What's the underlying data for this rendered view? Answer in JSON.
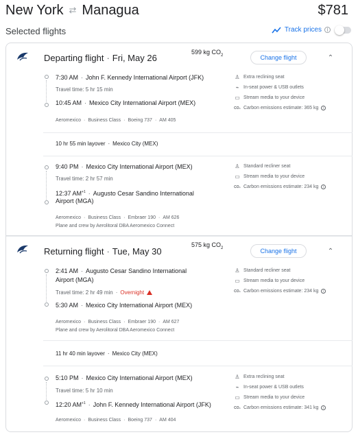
{
  "header": {
    "origin": "New York",
    "swap_glyph": "⇄",
    "destination": "Managua",
    "price": "$781"
  },
  "selected": {
    "label": "Selected flights",
    "track_label": "Track prices",
    "info_glyph": "i"
  },
  "departing": {
    "title": "Departing flight",
    "date": "Fri, May 26",
    "co2_value": "599 kg CO",
    "co2_sub": "2",
    "change_label": "Change flight",
    "segments": [
      {
        "dep_time": "7:30 AM",
        "dep_airport": "John F. Kennedy International Airport (JFK)",
        "travel_time": "Travel time: 5 hr 15 min",
        "arr_time": "10:45 AM",
        "arr_airport": "Mexico City International Airport (MEX)",
        "airline": "Aeromexico",
        "cabin": "Business Class",
        "aircraft": "Boeing 737",
        "flight_no": "AM 405",
        "amenities": [
          {
            "icon": "seat-icon",
            "text": "Extra reclining seat"
          },
          {
            "icon": "power-icon",
            "text": "In-seat power & USB outlets"
          },
          {
            "icon": "stream-icon",
            "text": "Stream media to your device"
          },
          {
            "icon": "co2-icon",
            "text": "Carbon emissions estimate: 365 kg"
          }
        ]
      },
      {
        "dep_time": "9:40 PM",
        "dep_airport": "Mexico City International Airport (MEX)",
        "travel_time": "Travel time: 2 hr 57 min",
        "arr_time": "12:37 AM",
        "arr_plus": "+1",
        "arr_airport": "Augusto Cesar Sandino International",
        "arr_airport2": "Airport (MGA)",
        "airline": "Aeromexico",
        "cabin": "Business Class",
        "aircraft": "Embraer 190",
        "flight_no": "AM 626",
        "operator": "Plane and crew by Aerolitoral DBA Aeromexico Connect",
        "amenities": [
          {
            "icon": "seat-icon",
            "text": "Standard recliner seat"
          },
          {
            "icon": "stream-icon",
            "text": "Stream media to your device"
          },
          {
            "icon": "co2-icon",
            "text": "Carbon emissions estimate: 234 kg"
          }
        ]
      }
    ],
    "layover": {
      "duration": "10 hr 55 min layover",
      "city": "Mexico City (MEX)"
    }
  },
  "returning": {
    "title": "Returning flight",
    "date": "Tue, May 30",
    "co2_value": "575 kg CO",
    "co2_sub": "2",
    "change_label": "Change flight",
    "segments": [
      {
        "dep_time": "2:41 AM",
        "dep_airport": "Augusto Cesar Sandino International",
        "dep_airport2": "Airport (MGA)",
        "travel_time": "Travel time: 2 hr 49 min",
        "overnight": "Overnight",
        "arr_time": "5:30 AM",
        "arr_airport": "Mexico City International Airport (MEX)",
        "airline": "Aeromexico",
        "cabin": "Business Class",
        "aircraft": "Embraer 190",
        "flight_no": "AM 627",
        "operator": "Plane and crew by Aerolitoral DBA Aeromexico Connect",
        "amenities": [
          {
            "icon": "seat-icon",
            "text": "Standard recliner seat"
          },
          {
            "icon": "stream-icon",
            "text": "Stream media to your device"
          },
          {
            "icon": "co2-icon",
            "text": "Carbon emissions estimate: 234 kg"
          }
        ]
      },
      {
        "dep_time": "5:10 PM",
        "dep_airport": "Mexico City International Airport (MEX)",
        "travel_time": "Travel time: 5 hr 10 min",
        "arr_time": "12:20 AM",
        "arr_plus": "+1",
        "arr_airport": "John F. Kennedy International Airport (JFK)",
        "airline": "Aeromexico",
        "cabin": "Business Class",
        "aircraft": "Boeing 737",
        "flight_no": "AM 404",
        "amenities": [
          {
            "icon": "seat-icon",
            "text": "Extra reclining seat"
          },
          {
            "icon": "power-icon",
            "text": "In-seat power & USB outlets"
          },
          {
            "icon": "stream-icon",
            "text": "Stream media to your device"
          },
          {
            "icon": "co2-icon",
            "text": "Carbon emissions estimate: 341 kg"
          }
        ]
      }
    ],
    "layover": {
      "duration": "11 hr 40 min layover",
      "city": "Mexico City (MEX)"
    }
  },
  "glyphs": {
    "middot": "·",
    "chevron_up": "⌃",
    "seat": "♙",
    "power": "⌁",
    "stream": "▭",
    "co2": "CO₂",
    "info": "i"
  },
  "colors": {
    "accent": "#1a73e8",
    "warning": "#d93025",
    "logo": "#1b3a6b"
  }
}
